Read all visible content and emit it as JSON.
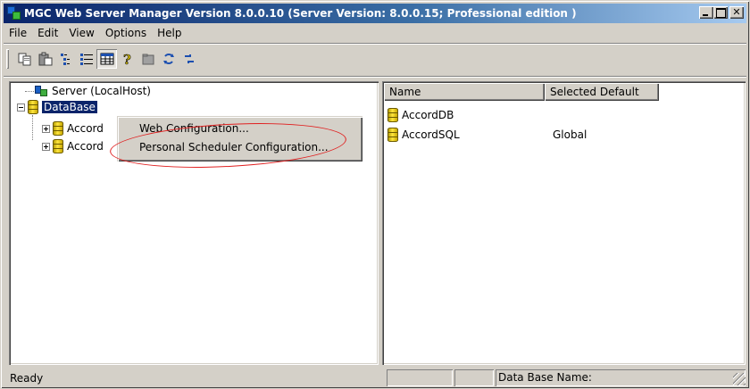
{
  "window": {
    "title": "MGC Web Server Manager Version 8.0.0.10  (Server Version: 8.0.0.15;  Professional edition )"
  },
  "menu": [
    "File",
    "Edit",
    "View",
    "Options",
    "Help"
  ],
  "toolbar": {
    "buttons": [
      "copy-icon",
      "paste-icon",
      "list-icon",
      "details-icon",
      "table-icon",
      "help-icon",
      "folder-icon",
      "refresh-icon",
      "sync-icon"
    ]
  },
  "tree": {
    "server_label": "Server (LocalHost)",
    "database_label": "DataBase",
    "child1_label": "Accord",
    "child2_label": "Accord"
  },
  "context_menu": {
    "items": [
      "Web Configuration...",
      "Personal Scheduler Configuration..."
    ]
  },
  "list": {
    "columns": [
      "Name",
      "Selected Default"
    ],
    "rows": [
      {
        "name": "AccordDB",
        "default": ""
      },
      {
        "name": "AccordSQL",
        "default": "Global"
      }
    ]
  },
  "status": {
    "text": "Ready",
    "db_name_label": "Data Base Name:"
  },
  "colors": {
    "title_active": "#0a246a",
    "face": "#d4d0c8",
    "annotation": "#e02020"
  }
}
